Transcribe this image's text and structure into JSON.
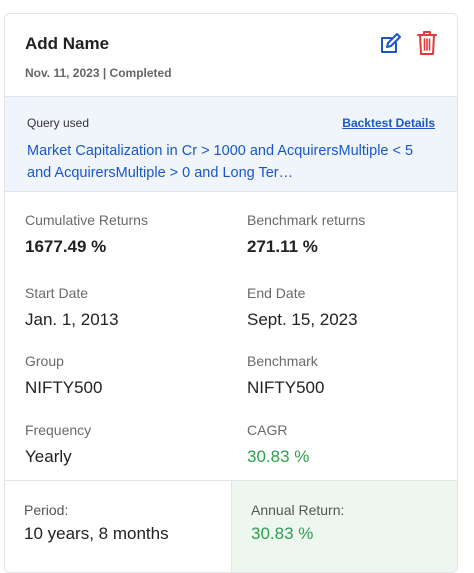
{
  "header": {
    "title": "Add Name",
    "subtitle": "Nov. 11, 2023 | Completed",
    "edit_icon": "edit-icon",
    "delete_icon": "trash-icon"
  },
  "query": {
    "label": "Query used",
    "details_link": "Backtest Details",
    "text": "Market Capitalization in Cr > 1000 and AcquirersMultiple < 5 and AcquirersMultiple > 0 and Long Ter…"
  },
  "stats": {
    "cumulative_returns": {
      "label": "Cumulative Returns",
      "value": "1677.49 %"
    },
    "benchmark_returns": {
      "label": "Benchmark returns",
      "value": "271.11 %"
    },
    "start_date": {
      "label": "Start Date",
      "value": "Jan. 1, 2013"
    },
    "end_date": {
      "label": "End Date",
      "value": "Sept. 15, 2023"
    },
    "group": {
      "label": "Group",
      "value": "NIFTY500"
    },
    "benchmark": {
      "label": "Benchmark",
      "value": "NIFTY500"
    },
    "frequency": {
      "label": "Frequency",
      "value": "Yearly"
    },
    "cagr": {
      "label": "CAGR",
      "value": "30.83 %"
    }
  },
  "footer": {
    "period_label": "Period:",
    "period_value": "10 years, 8 months",
    "annual_label": "Annual Return:",
    "annual_value": "30.83 %"
  },
  "colors": {
    "accent_blue": "#1a56c9",
    "delete_red": "#e03a3a",
    "positive_green": "#2e9e4f",
    "query_bg": "#eff5fb",
    "annual_bg": "#eef7ef"
  }
}
